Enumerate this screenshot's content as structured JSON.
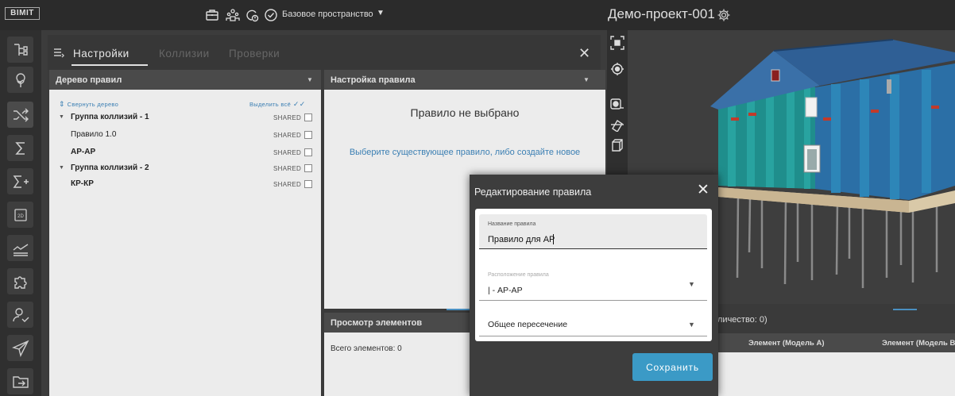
{
  "app": {
    "logo": "BIMIT"
  },
  "topbar": {
    "icons": [
      "briefcase-icon",
      "team-icon",
      "clock-alert-icon",
      "check-circle-icon"
    ],
    "space_label": "Базовое пространство",
    "project_title": "Демо-проект-001"
  },
  "left_toolbar": {
    "icons": [
      "tree-structure-icon",
      "tree-icon",
      "shuffle-icon",
      "sigma-icon",
      "sigma-plus-icon",
      "view-2d-icon",
      "chart-icon",
      "puzzle-icon",
      "user-check-icon",
      "send-icon",
      "folder-icon"
    ]
  },
  "main_panel": {
    "tabs": [
      {
        "label": "Настройки",
        "active": true
      },
      {
        "label": "Коллизии",
        "active": false
      },
      {
        "label": "Проверки",
        "active": false
      }
    ]
  },
  "rules_tree": {
    "title": "Дерево правил",
    "collapse_label": "Свернуть дерево",
    "select_all_label": "Выделить всё",
    "items": [
      {
        "label": "Группа коллизий - 1",
        "bold": true,
        "caret": true,
        "badge": "SHARED"
      },
      {
        "label": "Правило 1.0",
        "bold": false,
        "caret": false,
        "badge": "SHARED"
      },
      {
        "label": "АР-АР",
        "bold": true,
        "caret": false,
        "badge": "SHARED"
      },
      {
        "label": "Группа коллизий - 2",
        "bold": true,
        "caret": true,
        "badge": "SHARED"
      },
      {
        "label": "КР-КР",
        "bold": true,
        "caret": false,
        "badge": "SHARED"
      }
    ]
  },
  "rule_setup": {
    "title": "Настройка правила",
    "empty_title": "Правило не выбрано",
    "empty_hint": "Выберите существующее правило, либо создайте новое"
  },
  "element_view": {
    "title": "Просмотр элементов",
    "total": "Всего элементов: 0"
  },
  "collisions_table": {
    "count_text": "личество: 0)",
    "columns": [
      "Элемент (Модель А)",
      "Элемент (Модель В"
    ]
  },
  "dialog": {
    "title": "Редактирование правила",
    "name_label": "Название правила",
    "name_value": "Правило для АР",
    "location_label": "Расположение правила",
    "location_value": "| - АР-АР",
    "type_value": "Общее пересечение",
    "save_label": "Сохранить"
  },
  "colors": {
    "accent": "#3b9ac6",
    "link": "#3b7fb3",
    "house_wall": "#1f8e8c",
    "roof": "#2f5f95"
  }
}
